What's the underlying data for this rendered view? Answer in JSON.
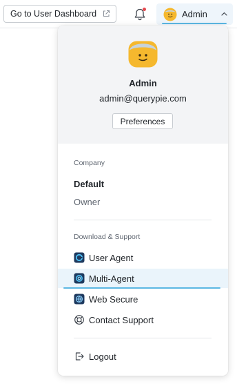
{
  "topbar": {
    "dashboard_button": "Go to User Dashboard",
    "user_label": "Admin"
  },
  "profile": {
    "name": "Admin",
    "email": "admin@querypie.com",
    "preferences_label": "Preferences"
  },
  "company": {
    "section_label": "Company",
    "name": "Default",
    "role": "Owner"
  },
  "support": {
    "section_label": "Download & Support",
    "items": [
      {
        "label": "User Agent",
        "icon": "user-agent-app-icon"
      },
      {
        "label": "Multi-Agent",
        "icon": "multi-agent-app-icon"
      },
      {
        "label": "Web Secure",
        "icon": "web-secure-app-icon"
      },
      {
        "label": "Contact Support",
        "icon": "lifebuoy-icon"
      }
    ]
  },
  "logout_label": "Logout",
  "colors": {
    "accent": "#5bb7e3",
    "avatar": "#f5b82e",
    "notification_dot": "#e5484d",
    "header_bg": "#f3f4f6",
    "hover_bg": "#eaf4fb"
  }
}
